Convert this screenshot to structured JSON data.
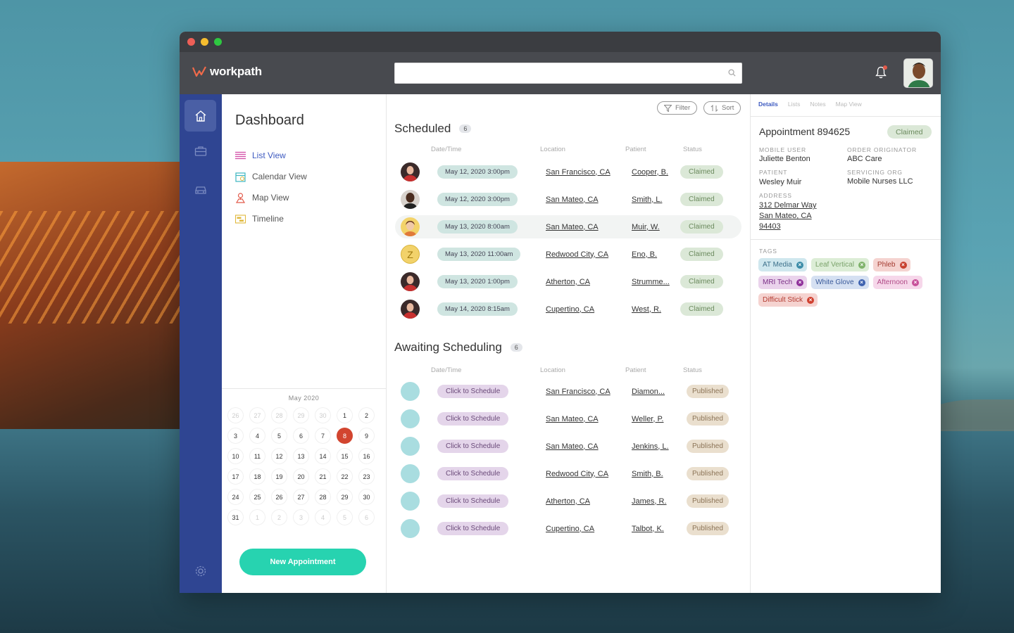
{
  "app": {
    "brand": "workpath",
    "search": {
      "placeholder": ""
    },
    "colors": {
      "accent": "#27d3b0",
      "rail": "#2f4592"
    }
  },
  "nav": {
    "title": "Dashboard",
    "items": [
      {
        "label": "List View",
        "icon": "list-icon"
      },
      {
        "label": "Calendar View",
        "icon": "calendar-icon"
      },
      {
        "label": "Map View",
        "icon": "map-pin-icon"
      },
      {
        "label": "Timeline",
        "icon": "timeline-icon"
      }
    ]
  },
  "calendar": {
    "month": "May 2020",
    "days": [
      {
        "d": "26",
        "m": true
      },
      {
        "d": "27",
        "m": true
      },
      {
        "d": "28",
        "m": true
      },
      {
        "d": "29",
        "m": true
      },
      {
        "d": "30",
        "m": true
      },
      {
        "d": "1"
      },
      {
        "d": "2"
      },
      {
        "d": "3"
      },
      {
        "d": "4"
      },
      {
        "d": "5"
      },
      {
        "d": "6"
      },
      {
        "d": "7"
      },
      {
        "d": "8",
        "t": true
      },
      {
        "d": "9"
      },
      {
        "d": "10"
      },
      {
        "d": "11"
      },
      {
        "d": "12"
      },
      {
        "d": "13"
      },
      {
        "d": "14"
      },
      {
        "d": "15"
      },
      {
        "d": "16"
      },
      {
        "d": "17"
      },
      {
        "d": "18"
      },
      {
        "d": "19"
      },
      {
        "d": "20"
      },
      {
        "d": "21"
      },
      {
        "d": "22"
      },
      {
        "d": "23"
      },
      {
        "d": "24"
      },
      {
        "d": "25"
      },
      {
        "d": "26"
      },
      {
        "d": "27"
      },
      {
        "d": "28"
      },
      {
        "d": "29"
      },
      {
        "d": "30"
      },
      {
        "d": "31"
      },
      {
        "d": "1",
        "m": true
      },
      {
        "d": "2",
        "m": true
      },
      {
        "d": "3",
        "m": true
      },
      {
        "d": "4",
        "m": true
      },
      {
        "d": "5",
        "m": true
      },
      {
        "d": "6",
        "m": true
      }
    ],
    "new_appointment": "New Appointment"
  },
  "toolbar": {
    "filter": "Filter",
    "sort": "Sort"
  },
  "scheduled": {
    "title": "Scheduled",
    "count": "6",
    "headers": {
      "date": "Date/Time",
      "location": "Location",
      "patient": "Patient",
      "status": "Status"
    },
    "rows": [
      {
        "date": "May 12, 2020 3:00pm",
        "location": "San Francisco, CA",
        "patient": "Cooper, B.",
        "status": "Claimed",
        "avatar": "avatar-red"
      },
      {
        "date": "May 12, 2020 3:00pm",
        "location": "San Mateo, CA",
        "patient": "Smith, L.",
        "status": "Claimed",
        "avatar": "avatar-dark"
      },
      {
        "date": "May 13, 2020 8:00am",
        "location": "San Mateo, CA",
        "patient": "Muir, W.",
        "status": "Claimed",
        "avatar": "avatar-woman"
      },
      {
        "date": "May 13, 2020 11:00am",
        "location": "Redwood City, CA",
        "patient": "Eno, B.",
        "status": "Claimed",
        "avatar": "avatar-initial",
        "initial": "Z"
      },
      {
        "date": "May 13, 2020 1:00pm",
        "location": "Atherton, CA",
        "patient": "Strumme...",
        "status": "Claimed",
        "avatar": "avatar-red"
      },
      {
        "date": "May 14, 2020 8:15am",
        "location": "Cupertino, CA",
        "patient": "West, R.",
        "status": "Claimed",
        "avatar": "avatar-red"
      }
    ]
  },
  "awaiting": {
    "title": "Awaiting Scheduling",
    "count": "6",
    "headers": {
      "date": "Date/Time",
      "location": "Location",
      "patient": "Patient",
      "status": "Status"
    },
    "rows": [
      {
        "action": "Click to Schedule",
        "location": "San Francisco, CA",
        "patient": "Diamon...",
        "status": "Published"
      },
      {
        "action": "Click to Schedule",
        "location": "San Mateo, CA",
        "patient": "Weller, P.",
        "status": "Published"
      },
      {
        "action": "Click to Schedule",
        "location": "San Mateo, CA",
        "patient": "Jenkins, L.",
        "status": "Published"
      },
      {
        "action": "Click to Schedule",
        "location": "Redwood City, CA",
        "patient": "Smith, B.",
        "status": "Published"
      },
      {
        "action": "Click to Schedule",
        "location": "Atherton, CA",
        "patient": "James, R.",
        "status": "Published"
      },
      {
        "action": "Click to Schedule",
        "location": "Cupertino, CA",
        "patient": "Talbot, K.",
        "status": "Published"
      }
    ]
  },
  "detail": {
    "tabs": [
      "Details",
      "Lists",
      "Notes",
      "Map View"
    ],
    "title": "Appointment 894625",
    "status": "Claimed",
    "mobile_user_label": "Mobile User",
    "mobile_user": "Juliette Benton",
    "order_originator_label": "Order Originator",
    "order_originator": "ABC Care",
    "patient_label": "Patient",
    "patient": "Wesley Muir",
    "servicing_org_label": "Servicing Org",
    "servicing_org": "Mobile Nurses LLC",
    "address_label": "Address",
    "address": [
      "312 Delmar Way",
      "San Mateo, CA",
      "94403"
    ],
    "tags_label": "Tags",
    "tags": [
      {
        "label": "AT Media",
        "bg": "#cfe7ee",
        "fg": "#3b6f8a",
        "x": "#3b8ca8"
      },
      {
        "label": "Leaf Vertical",
        "bg": "#dcedd6",
        "fg": "#7aa26a",
        "x": "#7fb36b"
      },
      {
        "label": "Phleb",
        "bg": "#f5d3d0",
        "fg": "#a33a30",
        "x": "#c8402f"
      },
      {
        "label": "MRI Tech",
        "bg": "#ead3ec",
        "fg": "#7a2f86",
        "x": "#8f2f9a"
      },
      {
        "label": "White Glove",
        "bg": "#d5e0f2",
        "fg": "#3a5a9a",
        "x": "#3e62b0"
      },
      {
        "label": "Afternoon",
        "bg": "#f6d7ea",
        "fg": "#b04a86",
        "x": "#c8509a"
      },
      {
        "label": "Difficult Stick",
        "bg": "#f5d3d0",
        "fg": "#b33a30",
        "x": "#d0402f"
      }
    ]
  }
}
